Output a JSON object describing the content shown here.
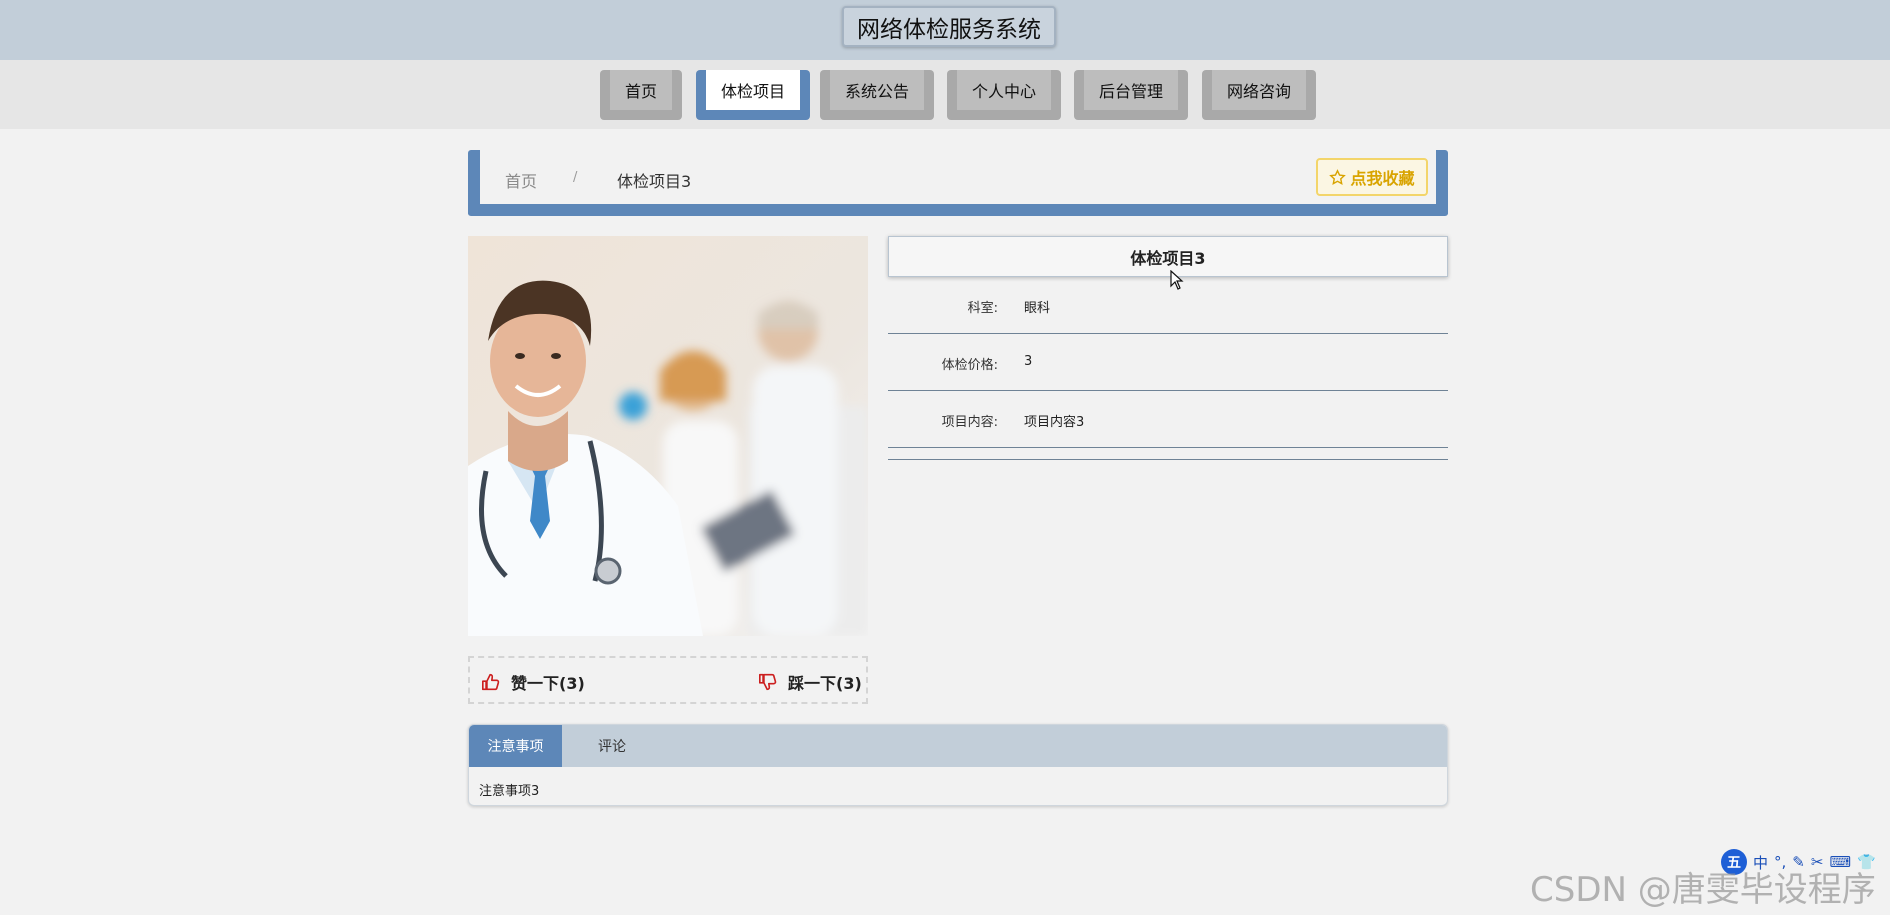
{
  "header": {
    "title": "网络体检服务系统"
  },
  "nav": {
    "items": [
      {
        "label": "首页",
        "active": false
      },
      {
        "label": "体检项目",
        "active": true
      },
      {
        "label": "系统公告",
        "active": false
      },
      {
        "label": "个人中心",
        "active": false
      },
      {
        "label": "后台管理",
        "active": false
      },
      {
        "label": "网络咨询",
        "active": false
      }
    ]
  },
  "breadcrumb": {
    "home": "首页",
    "separator": "/",
    "current": "体检项目3"
  },
  "favorite": {
    "icon": "star-outline-icon",
    "label": "点我收藏"
  },
  "detail": {
    "title": "体检项目3",
    "fields": [
      {
        "label": "科室:",
        "value": "眼科"
      },
      {
        "label": "体检价格:",
        "value": "3"
      },
      {
        "label": "项目内容:",
        "value": "项目内容3"
      }
    ]
  },
  "votes": {
    "like": {
      "icon": "thumbs-up-icon",
      "label": "赞一下(3)"
    },
    "dislike": {
      "icon": "thumbs-down-icon",
      "label": "踩一下(3)"
    }
  },
  "tabs": {
    "items": [
      {
        "label": "注意事项",
        "active": true
      },
      {
        "label": "评论",
        "active": false
      }
    ],
    "content": "注意事项3"
  },
  "ime": {
    "logo": "五",
    "items": [
      "中",
      "°,",
      "✎",
      "✂",
      "⌨",
      "👕"
    ]
  },
  "watermark": "CSDN @唐雯毕设程序",
  "colors": {
    "accent": "#5d87b8",
    "header": "#c2ced9",
    "favorite": "#d9a400",
    "vote_icon": "#cc1f1f"
  }
}
